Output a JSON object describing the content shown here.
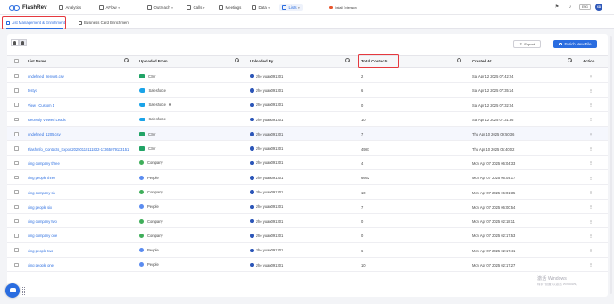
{
  "app": {
    "logo_text": "FlashRev"
  },
  "nav": [
    {
      "label": "Analytics",
      "dropdown": false,
      "active": false
    },
    {
      "label": "AFlow",
      "dropdown": true,
      "active": false
    },
    {
      "label": "Outreach",
      "dropdown": true,
      "active": false
    },
    {
      "label": "Calls",
      "dropdown": true,
      "active": false
    },
    {
      "label": "Meetings",
      "dropdown": false,
      "active": false
    },
    {
      "label": "Data",
      "dropdown": true,
      "active": false
    },
    {
      "label": "Lists",
      "dropdown": true,
      "active": true
    }
  ],
  "topbar": {
    "extension_label": "Install Extension",
    "language": "ENG",
    "avatar_initials": "XD"
  },
  "tabs": [
    {
      "label": "List Management & Enrichment",
      "active": true
    },
    {
      "label": "Business Card Enrichment",
      "active": false
    }
  ],
  "toolbar": {
    "export_label": "Export",
    "enrich_label": "Enrich New File"
  },
  "table": {
    "headers": {
      "list_name": "List Name",
      "uploaded_from": "Uploaded From",
      "uploaded_by": "Uploaded By",
      "total_contacts": "Total Contacts",
      "created_at": "Created At",
      "action": "Action"
    },
    "rows": [
      {
        "name": "undefined_8envx6.csv",
        "source": "CSV",
        "source_icon": "csv-icon",
        "by": "zhe yuan091301",
        "total": "2",
        "created": "Sat Apr 12 2025 07:42:24"
      },
      {
        "name": "testyo",
        "source": "Salesforce",
        "source_icon": "salesforce-icon",
        "by": "zhe yuan091301",
        "total": "6",
        "created": "Sat Apr 12 2025 07:35:14"
      },
      {
        "name": "View - Custom 1",
        "source": "Salesforce",
        "source_icon": "salesforce-icon",
        "by": "zhe yuan091301",
        "total": "0",
        "created": "Sat Apr 12 2025 07:32:04",
        "info": true
      },
      {
        "name": "Recently Viewed Leads",
        "source": "Salesforce",
        "source_icon": "salesforce-icon",
        "by": "zhe yuan091301",
        "total": "10",
        "created": "Sat Apr 12 2025 07:31:36"
      },
      {
        "name": "undefined_1205.csv",
        "source": "CSV",
        "source_icon": "csv-icon",
        "by": "zhe yuan091301",
        "total": "7",
        "created": "Thu Apr 10 2025 09:50:36",
        "hover": true
      },
      {
        "name": "FlashInfo_Contacts_Export20250110111832-17365079113151",
        "source": "CSV",
        "source_icon": "csv-icon",
        "by": "zhe yuan091301",
        "total": "4987",
        "created": "Thu Apr 10 2025 06:40:02"
      },
      {
        "name": "xing company three",
        "source": "Company",
        "source_icon": "company-icon",
        "by": "zhe yuan091301",
        "total": "4",
        "created": "Mon Apr 07 2025 06:04:33"
      },
      {
        "name": "xing people three",
        "source": "People",
        "source_icon": "people-icon",
        "by": "zhe yuan091301",
        "total": "6662",
        "created": "Mon Apr 07 2025 06:04:17"
      },
      {
        "name": "xing company six",
        "source": "Company",
        "source_icon": "company-icon",
        "by": "zhe yuan091301",
        "total": "10",
        "created": "Mon Apr 07 2025 06:01:35"
      },
      {
        "name": "xing people six",
        "source": "People",
        "source_icon": "people-icon",
        "by": "zhe yuan091301",
        "total": "7",
        "created": "Mon Apr 07 2025 06:00:54"
      },
      {
        "name": "xing company two",
        "source": "Company",
        "source_icon": "company-icon",
        "by": "zhe yuan091301",
        "total": "0",
        "created": "Mon Apr 07 2025 02:18:11"
      },
      {
        "name": "xing company one",
        "source": "Company",
        "source_icon": "company-icon",
        "by": "zhe yuan091301",
        "total": "0",
        "created": "Mon Apr 07 2025 02:17:53"
      },
      {
        "name": "xing people two",
        "source": "People",
        "source_icon": "people-icon",
        "by": "zhe yuan091301",
        "total": "6",
        "created": "Mon Apr 07 2025 02:17:41"
      },
      {
        "name": "xing people one",
        "source": "People",
        "source_icon": "people-icon",
        "by": "zhe yuan091301",
        "total": "10",
        "created": "Mon Apr 07 2025 02:17:27"
      }
    ],
    "action_glyph": "⋮"
  },
  "watermark": {
    "line1": "激活 Windows",
    "line2": "转到\"设置\"以激活 Windows。"
  },
  "colors": {
    "accent": "#2a6de0",
    "highlight_box": "#e5393f",
    "csv": "#21a366",
    "salesforce": "#1aa3e8"
  }
}
